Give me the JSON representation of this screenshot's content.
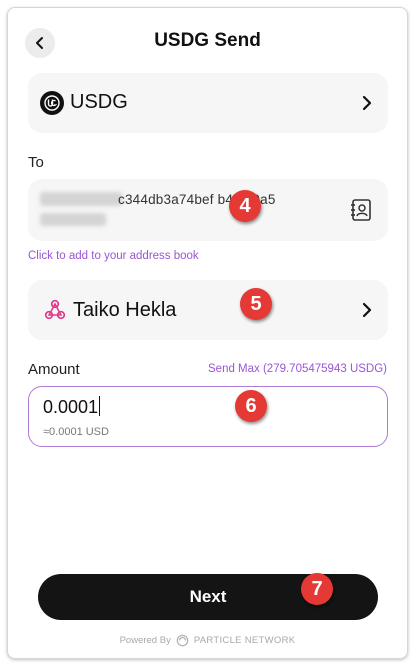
{
  "header": {
    "title": "USDG Send",
    "back_icon": "chevron-left-icon"
  },
  "token": {
    "symbol": "USDG",
    "logo_icon": "usdg-logo-icon"
  },
  "recipient": {
    "label": "To",
    "address_visible": "c344db3a74bef  b4dfa9a5",
    "address_book_link": "Click to add to your address book",
    "address_book_icon": "contact-card-icon"
  },
  "network": {
    "name": "Taiko Hekla",
    "icon": "taiko-logo-icon"
  },
  "amount": {
    "label": "Amount",
    "send_max": "Send Max (279.705475943 USDG)",
    "value": "0.0001",
    "usd_value": "≈0.0001 USD"
  },
  "actions": {
    "next_label": "Next"
  },
  "footer": {
    "powered_by": "Powered By",
    "brand": "PARTICLE NETWORK"
  },
  "annotations": {
    "badge_4": "4",
    "badge_5": "5",
    "badge_6": "6",
    "badge_7": "7"
  },
  "colors": {
    "accent": "#9a56d4",
    "badge": "#e53935",
    "button": "#141414"
  }
}
